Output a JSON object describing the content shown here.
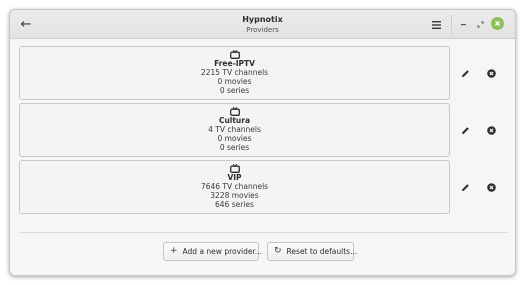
{
  "window": {
    "title": "Hypnotix",
    "subtitle": "Providers"
  },
  "icons": {
    "back": "back-arrow-icon",
    "menu": "hamburger-menu-icon",
    "minimize": "minimize-icon",
    "maximize": "maximize-icon",
    "close": "close-icon",
    "tv": "tv-icon",
    "edit": "pencil-icon",
    "remove": "remove-circle-icon",
    "add": "plus-icon",
    "reset": "reset-icon"
  },
  "colors": {
    "close_button": "#8fbf5a",
    "window_bg": "#f6f6f6",
    "row_border": "#c7c7c7"
  },
  "providers": [
    {
      "name": "Free-IPTV",
      "channels": "2215 TV channels",
      "movies": "0 movies",
      "series": "0 series"
    },
    {
      "name": "Cultura",
      "channels": "4 TV channels",
      "movies": "0 movies",
      "series": "0 series"
    },
    {
      "name": "VIP",
      "channels": "7646 TV channels",
      "movies": "3228 movies",
      "series": "646 series"
    }
  ],
  "footer": {
    "add_label": "Add a new provider...",
    "reset_label": "Reset to defaults..."
  }
}
